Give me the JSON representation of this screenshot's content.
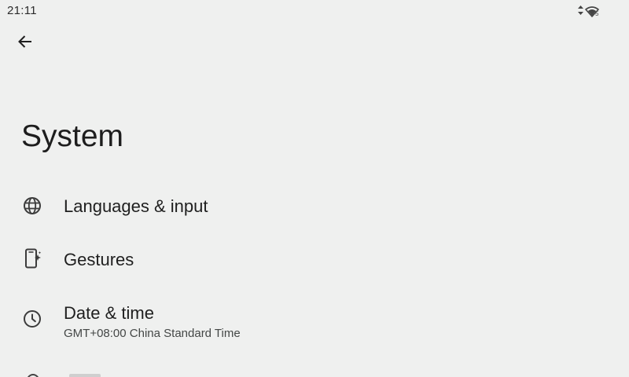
{
  "status_bar": {
    "time": "21:11",
    "icons": [
      "data-arrows-icon",
      "wifi-icon"
    ],
    "wifi_badge": "5"
  },
  "toolbar": {
    "back_icon": "arrow-back-icon"
  },
  "page": {
    "title": "System"
  },
  "items": [
    {
      "icon": "globe-icon",
      "title": "Languages & input",
      "summary": ""
    },
    {
      "icon": "gesture-phone-icon",
      "title": "Gestures",
      "summary": ""
    },
    {
      "icon": "clock-icon",
      "title": "Date & time",
      "summary": "GMT+08:00 China Standard Time"
    }
  ],
  "colors": {
    "background": "#eff0ef",
    "text_primary": "#1f1f1f",
    "text_secondary": "#444746",
    "icon": "#3c3c3c"
  }
}
